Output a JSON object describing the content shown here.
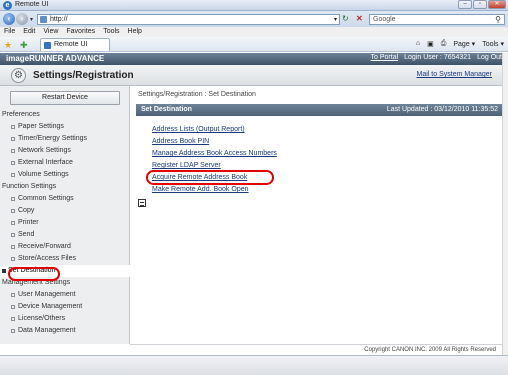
{
  "window": {
    "title": "Remote UI",
    "minimize": "–",
    "maximize": "▫",
    "close": "✕"
  },
  "address": {
    "url": "http://",
    "search_placeholder": "Google"
  },
  "menu": [
    "File",
    "Edit",
    "View",
    "Favorites",
    "Tools",
    "Help"
  ],
  "tab": {
    "label": "Remote UI"
  },
  "toolbar": {
    "home": "⌂",
    "feeds": "▣",
    "print": "⎙",
    "page": "Page ▾",
    "tools": "Tools ▾"
  },
  "rui": {
    "product": "imageRUNNER ADVANCE",
    "to_portal": "To Portal",
    "login_user": "Login User : 7654321",
    "logout": "Log Out"
  },
  "settings": {
    "title": "Settings/Registration",
    "mail_link": "Mail to System Manager"
  },
  "sidebar": {
    "restart": "Restart Device",
    "sections": [
      {
        "type": "head",
        "label": "Preferences"
      },
      {
        "type": "item",
        "label": "Paper Settings"
      },
      {
        "type": "item",
        "label": "Timer/Energy Settings"
      },
      {
        "type": "item",
        "label": "Network Settings"
      },
      {
        "type": "item",
        "label": "External Interface"
      },
      {
        "type": "item",
        "label": "Volume Settings"
      },
      {
        "type": "head",
        "label": "Function Settings"
      },
      {
        "type": "item",
        "label": "Common Settings"
      },
      {
        "type": "item",
        "label": "Copy"
      },
      {
        "type": "item",
        "label": "Printer"
      },
      {
        "type": "item",
        "label": "Send"
      },
      {
        "type": "item",
        "label": "Receive/Forward"
      },
      {
        "type": "item",
        "label": "Store/Access Files"
      },
      {
        "type": "active",
        "label": "Set Destination"
      },
      {
        "type": "head",
        "label": "Management Settings"
      },
      {
        "type": "item",
        "label": "User Management"
      },
      {
        "type": "item",
        "label": "Device Management"
      },
      {
        "type": "item",
        "label": "License/Others"
      },
      {
        "type": "item",
        "label": "Data Management"
      }
    ]
  },
  "main": {
    "breadcrumb": "Settings/Registration : Set Destination",
    "section_title": "Set Destination",
    "last_updated": "Last Updated : 03/12/2010 11:35:52",
    "links": [
      "Address Lists (Output Report)",
      "Address Book PIN",
      "Manage Address Book Access Numbers",
      "Register LDAP Server",
      "Acquire Remote Address Book",
      "Make Remote Add. Book Open"
    ]
  },
  "footer": {
    "copyright": "Copyright CANON INC. 2009 All Rights Reserved"
  },
  "colors": {
    "header_bar": "#4d6177",
    "link": "#1b3a80",
    "highlight_circle": "#e00000"
  }
}
